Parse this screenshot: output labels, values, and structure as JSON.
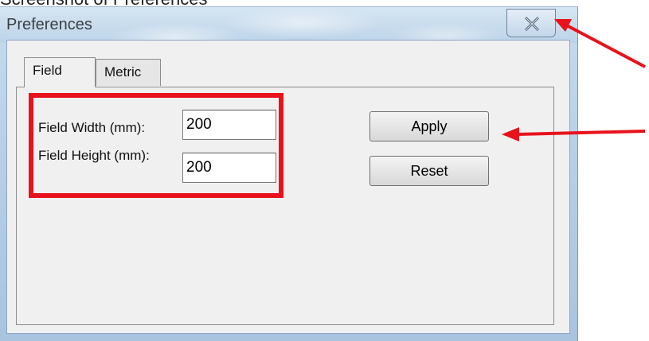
{
  "page_caption": "Screenshot of Preferences",
  "window": {
    "title": "Preferences",
    "close_icon": "close-icon"
  },
  "tabs": [
    {
      "label": "Field",
      "selected": true
    },
    {
      "label": "Metric",
      "selected": false
    }
  ],
  "form": {
    "width_label": "Field Width (mm):",
    "width_value": "200",
    "height_label": "Field Height (mm):",
    "height_value": "200"
  },
  "buttons": {
    "apply_label": "Apply",
    "reset_label": "Reset"
  },
  "annotations": {
    "highlight_color": "#e8121c",
    "arrow_color": "#e8121c"
  }
}
